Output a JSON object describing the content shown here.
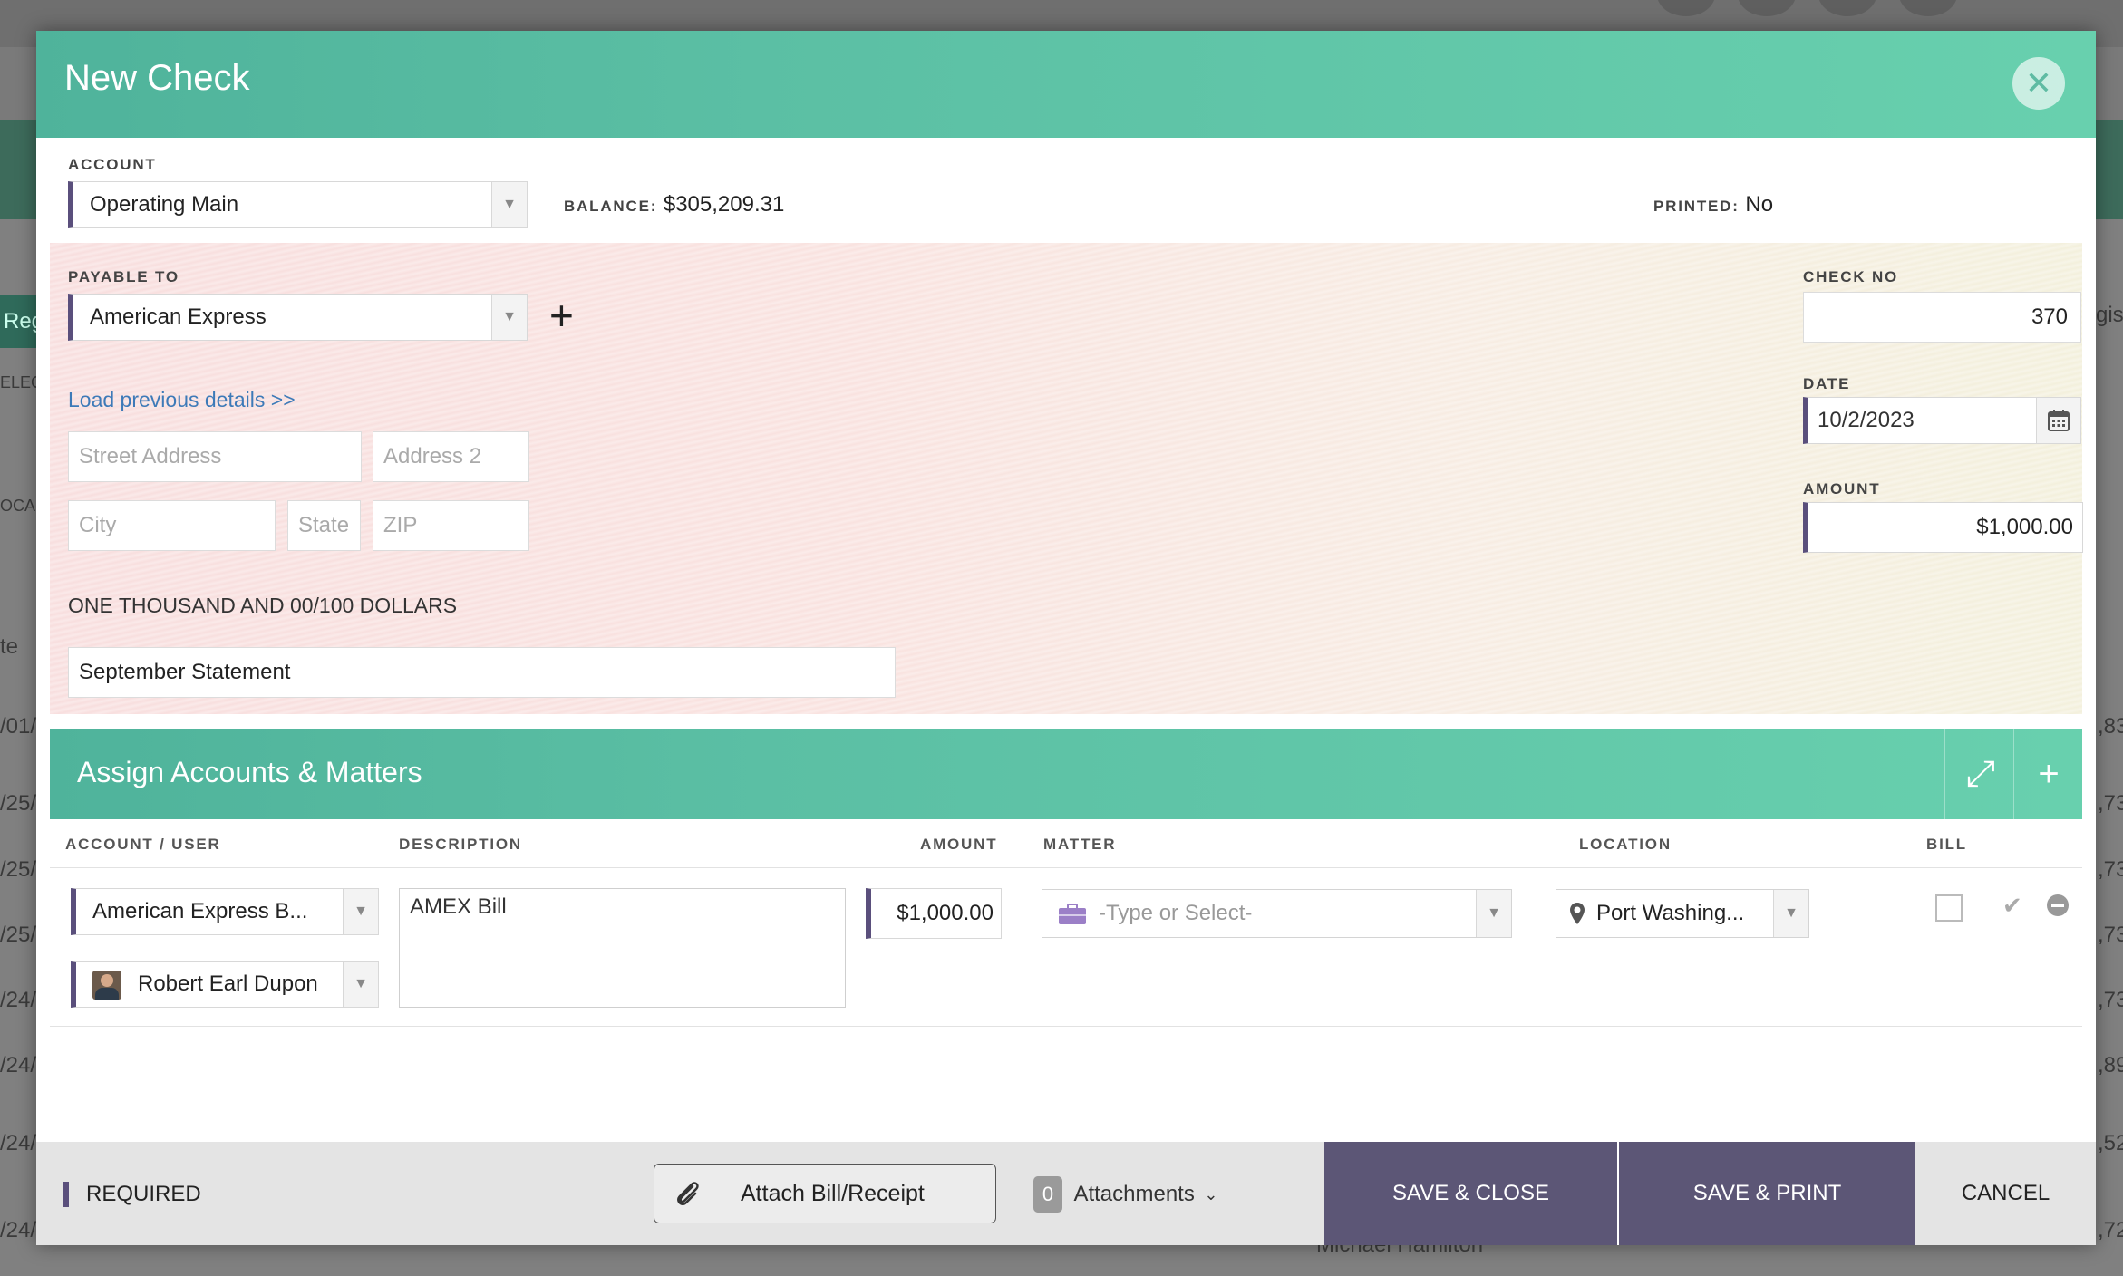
{
  "background": {
    "tab_label": "Reg",
    "side_labels": [
      "ELEC",
      "OCA"
    ],
    "right_tab_label": "gis",
    "left_dates": [
      "te",
      "/01/",
      "/25/",
      "/25/",
      "/25/",
      "/24/",
      "/24/",
      "/24/",
      "/24/"
    ],
    "right_values": [
      ",83",
      ",73",
      ",73",
      ",73",
      ",73",
      ",89",
      ",52",
      ",72"
    ],
    "footer_name": "Michael Hamilton"
  },
  "modal": {
    "title": "New Check",
    "close_glyph": "✕",
    "account": {
      "label": "ACCOUNT",
      "value": "Operating Main",
      "balance_label": "BALANCE:",
      "balance_value": "$305,209.31",
      "printed_label": "PRINTED:",
      "printed_value": "No"
    },
    "check": {
      "payable_label": "PAYABLE TO",
      "payable_value": "American Express",
      "add_glyph": "+",
      "load_link": "Load previous details >>",
      "street_placeholder": "Street Address",
      "address2_placeholder": "Address 2",
      "city_placeholder": "City",
      "state_placeholder": "State",
      "zip_placeholder": "ZIP",
      "amount_words": "ONE THOUSAND AND 00/100 DOLLARS",
      "memo": "September Statement",
      "check_no_label": "CHECK NO",
      "check_no": "370",
      "date_label": "DATE",
      "date": "10/2/2023",
      "amount_label": "AMOUNT",
      "amount": "$1,000.00"
    },
    "assign": {
      "title": "Assign Accounts & Matters",
      "expand_glyph": "⤢",
      "add_glyph": "+",
      "columns": {
        "account_user": "ACCOUNT / USER",
        "description": "DESCRIPTION",
        "amount": "AMOUNT",
        "matter": "MATTER",
        "location": "LOCATION",
        "bill": "BILL"
      },
      "row": {
        "account": "American Express B...",
        "user": "Robert Earl Dupon",
        "description": "AMEX Bill",
        "amount": "$1,000.00",
        "matter_placeholder": "-Type or Select-",
        "location": "Port Washing..."
      }
    },
    "footer": {
      "required": "REQUIRED",
      "attach": "Attach Bill/Receipt",
      "attachments_count": "0",
      "attachments_label": "Attachments",
      "save_close": "SAVE & CLOSE",
      "save_print": "SAVE & PRINT",
      "cancel": "CANCEL"
    }
  },
  "colors": {
    "header_green": "#5bbfa4",
    "required_purple": "#5a4f7c",
    "button_purple": "#5c5676",
    "link_blue": "#3d7ab8"
  }
}
